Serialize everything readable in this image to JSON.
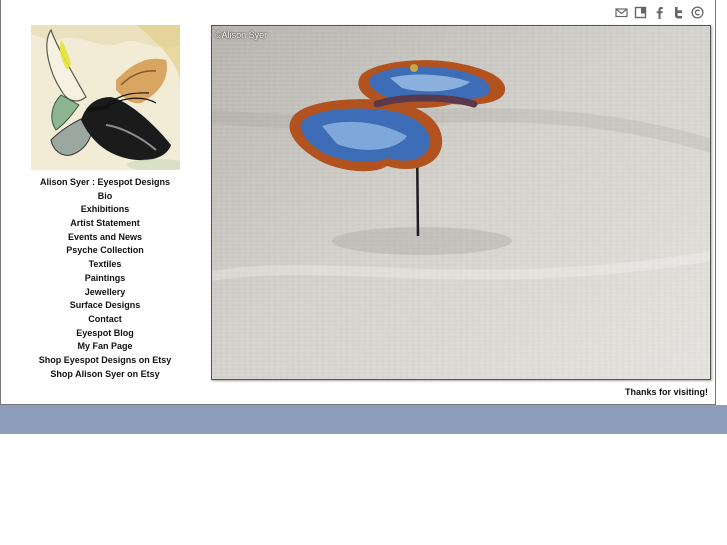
{
  "site": {
    "nav": [
      "Alison Syer : Eyespot Designs",
      "Bio",
      "Exhibitions",
      "Artist Statement",
      "Events and News",
      "Psyche Collection",
      "Textiles",
      "Paintings",
      "Jewellery",
      "Surface Designs",
      "Contact",
      "Eyespot Blog",
      "My Fan Page",
      "Shop Eyespot Designs on Etsy",
      "Shop Alison Syer on Etsy"
    ],
    "photo_caption": "©Alison Syer",
    "footer_text": "Thanks for visiting!"
  },
  "icons": [
    "mail-icon",
    "bookmark-icon",
    "facebook-icon",
    "twitter-icon",
    "copyright-icon"
  ],
  "colors": {
    "band": "#8c9dba",
    "frame_border": "#777777",
    "text": "#111111"
  }
}
